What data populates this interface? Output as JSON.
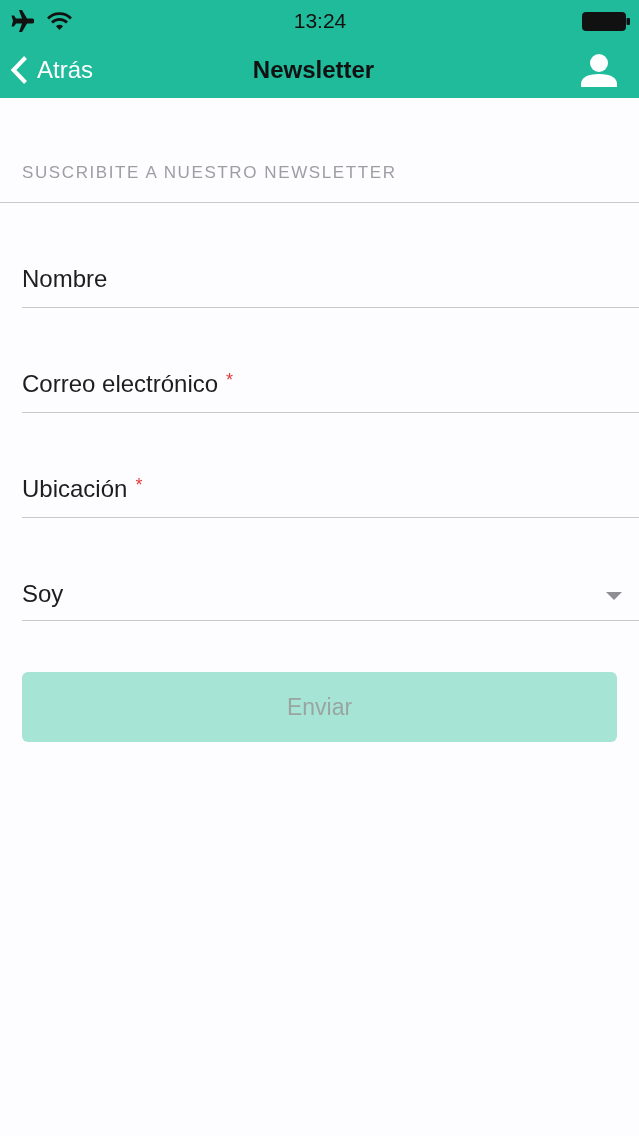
{
  "status_bar": {
    "time": "13:24"
  },
  "nav_bar": {
    "back_label": "Atrás",
    "title": "Newsletter"
  },
  "section_header": "SUSCRIBITE A NUESTRO NEWSLETTER",
  "fields": [
    {
      "kind": "text",
      "placeholder": "Nombre"
    },
    {
      "kind": "text",
      "placeholder": "Correo electrónico",
      "required_mark": "*"
    },
    {
      "kind": "text",
      "placeholder": "Ubicación",
      "required_mark": "*"
    },
    {
      "kind": "select",
      "placeholder": "Soy"
    }
  ],
  "submit_button": {
    "label": "Enviar",
    "disabled": true
  }
}
